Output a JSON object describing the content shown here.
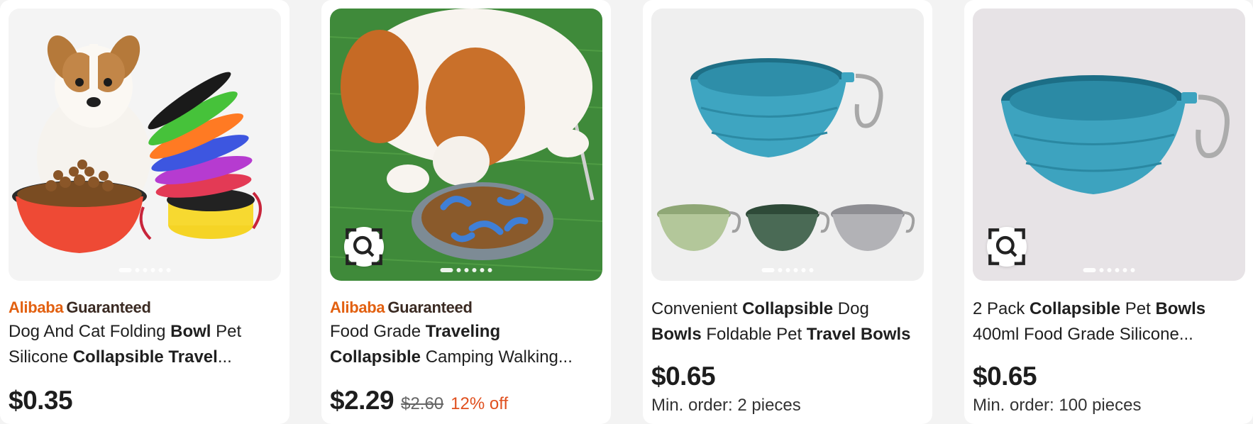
{
  "colors": {
    "alibaba_orange": "#e26010",
    "guaranteed_dark": "#3a2a22",
    "discount_red": "#e0501f"
  },
  "cards": [
    {
      "badge": {
        "brand": "Alibaba",
        "label": "Guaranteed"
      },
      "title_parts": [
        {
          "text": "Dog And Cat Folding ",
          "bold": false
        },
        {
          "text": "Bowl",
          "bold": true
        },
        {
          "text": " Pet Silicone ",
          "bold": false
        },
        {
          "text": "Collapsible Travel",
          "bold": true
        },
        {
          "text": "...",
          "bold": false
        }
      ],
      "price": "$0.35",
      "image_alt": "Puppy with stack of colorful collapsible bowls"
    },
    {
      "badge": {
        "brand": "Alibaba",
        "label": "Guaranteed"
      },
      "title_parts": [
        {
          "text": "Food Grade ",
          "bold": false
        },
        {
          "text": "Traveling",
          "bold": true
        },
        {
          "text": " ",
          "bold": false
        },
        {
          "text": "Collapsible",
          "bold": true
        },
        {
          "text": " Camping Walking...",
          "bold": false
        }
      ],
      "price": "$2.29",
      "old_price": "$2.60",
      "discount": "12% off",
      "image_alt": "Dog eating from slow feeder bowl on grass"
    },
    {
      "title_parts": [
        {
          "text": "Convenient ",
          "bold": false
        },
        {
          "text": "Collapsible",
          "bold": true
        },
        {
          "text": " Dog ",
          "bold": false
        },
        {
          "text": "Bowls",
          "bold": true
        },
        {
          "text": " Foldable Pet ",
          "bold": false
        },
        {
          "text": "Travel Bowls",
          "bold": true
        }
      ],
      "price": "$0.65",
      "min_order": "Min. order: 2 pieces",
      "image_alt": "Blue collapsible bowl with carabiner and three color variants"
    },
    {
      "title_parts": [
        {
          "text": "2 Pack ",
          "bold": false
        },
        {
          "text": "Collapsible",
          "bold": true
        },
        {
          "text": " Pet ",
          "bold": false
        },
        {
          "text": "Bowls",
          "bold": true
        },
        {
          "text": " 400ml Food Grade Silicone...",
          "bold": false
        }
      ],
      "price": "$0.65",
      "min_order": "Min. order: 100 pieces",
      "image_alt": "Blue collapsible silicone bowl with carabiner"
    }
  ],
  "icons": {
    "image_search": "image-search-icon"
  }
}
